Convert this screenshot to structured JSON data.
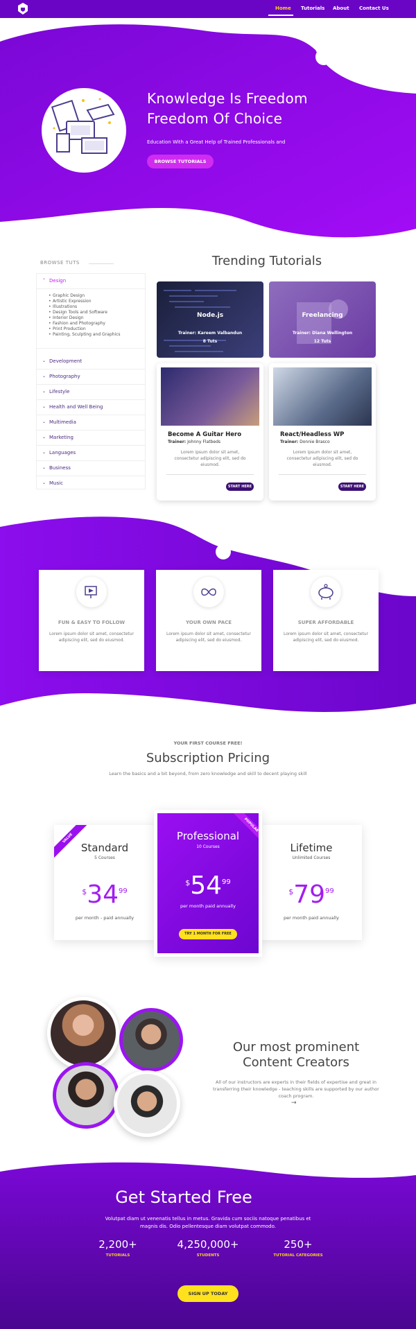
{
  "nav": {
    "items": [
      {
        "label": "Home"
      },
      {
        "label": "Tutorials"
      },
      {
        "label": "About"
      },
      {
        "label": "Contact Us"
      }
    ]
  },
  "hero": {
    "title_line1": "Knowledge Is Freedom",
    "title_line2": "Freedom Of Choice",
    "subtitle": "Education With a Great Help of Trained Professionals and",
    "button": "BROWSE TUTORIALS"
  },
  "sidebar": {
    "heading": "BROWSE TUTS",
    "open_category": "Design",
    "subitems": [
      "Graphic Design",
      "Artistic Expression",
      "Illustrations",
      "Design Tools and Software",
      "Interior Design",
      "Fashion and Photography",
      "Print Production",
      "Painting, Sculpting and Graphics"
    ],
    "categories": [
      "Development",
      "Photography",
      "Lifestyle",
      "Health and Well Being",
      "Multimedia",
      "Marketing",
      "Languages",
      "Business",
      "Music"
    ]
  },
  "trending": {
    "title": "Trending Tutorials",
    "top_cards": [
      {
        "title": "Node.js",
        "trainer": "Trainer: Kareem Valbandun",
        "count": "8 Tuts"
      },
      {
        "title": "Freelancing",
        "trainer": "Trainer: Diana Wellington",
        "count": "12 Tuts"
      }
    ],
    "cards": [
      {
        "title": "Become A Guitar Hero",
        "trainer_label": "Trainer:",
        "trainer": "Johnny Flatbeds",
        "desc": "Lorem ipsum dolor sit amet, consectetur adipiscing elit, sed do eiusmod.",
        "button": "START HERE"
      },
      {
        "title": "React/Headless WP",
        "trainer_label": "Trainer:",
        "trainer": "Donnie Brasco",
        "desc": "Lorem ipsum dolor sit amet, consectetur adipiscing elit, sed do eiusmod.",
        "button": "START HERE"
      }
    ]
  },
  "features": [
    {
      "icon": "presentation-icon",
      "title": "FUN & EASY TO FOLLOW",
      "desc": "Lorem ipsum dolor sit amet, consectetur adipiscing elit, sed do eiusmod."
    },
    {
      "icon": "infinity-icon",
      "title": "YOUR OWN PACE",
      "desc": "Lorem ipsum dolor sit amet, consectetur adipiscing elit, sed do eiusmod."
    },
    {
      "icon": "piggy-bank-icon",
      "title": "SUPER AFFORDABLE",
      "desc": "Lorem ipsum dolor sit amet, consectetur adipiscing elit, sed do eiusmod."
    }
  ],
  "pricing": {
    "eyebrow": "YOUR FIRST COURSE FREE!",
    "title": "Subscription Pricing",
    "subtitle": "Learn the basics and a bit beyond, from zero knowledge and skill to decent playing skill",
    "plans": [
      {
        "ribbon": "VALUE",
        "name": "Standard",
        "count": "5 Courses",
        "currency": "$",
        "amount": "34",
        "cents": "99",
        "period": "per month - paid annually"
      },
      {
        "ribbon": "POPULAR",
        "name": "Professional",
        "count": "10 Courses",
        "currency": "$",
        "amount": "54",
        "cents": "99",
        "period": "per month paid annually",
        "button": "TRY 1 MONTH FOR FREE"
      },
      {
        "name": "Lifetime",
        "count": "Unlimited Courses",
        "currency": "$",
        "amount": "79",
        "cents": "99",
        "period": "per month paid annually"
      }
    ]
  },
  "creators": {
    "title_line1": "Our most prominent",
    "title_line2": "Content Creators",
    "desc": "All of our instructors are experts in their fields of expertise and great in transferring their knowledge - teaching skills are supported by our author coach program.",
    "arrow": "→"
  },
  "cta": {
    "title": "Get Started Free",
    "desc": "Volutpat diam ut venenatis tellus in metus. Gravida cum sociis natoque penatibus et magnis dis. Odio pellentesque diam volutpat commodo.",
    "stats": [
      {
        "number": "2,200+",
        "label": "TUTORIALS"
      },
      {
        "number": "4,250,000+",
        "label": "STUDENTS"
      },
      {
        "number": "250+",
        "label": "TUTORIAL CATEGORIES"
      }
    ],
    "button": "SIGN UP TODAY"
  },
  "colors": {
    "primary": "#8a0cf0",
    "dark": "#5a0aa8",
    "accent": "#ffd21e",
    "pink": "#d02cf0"
  }
}
